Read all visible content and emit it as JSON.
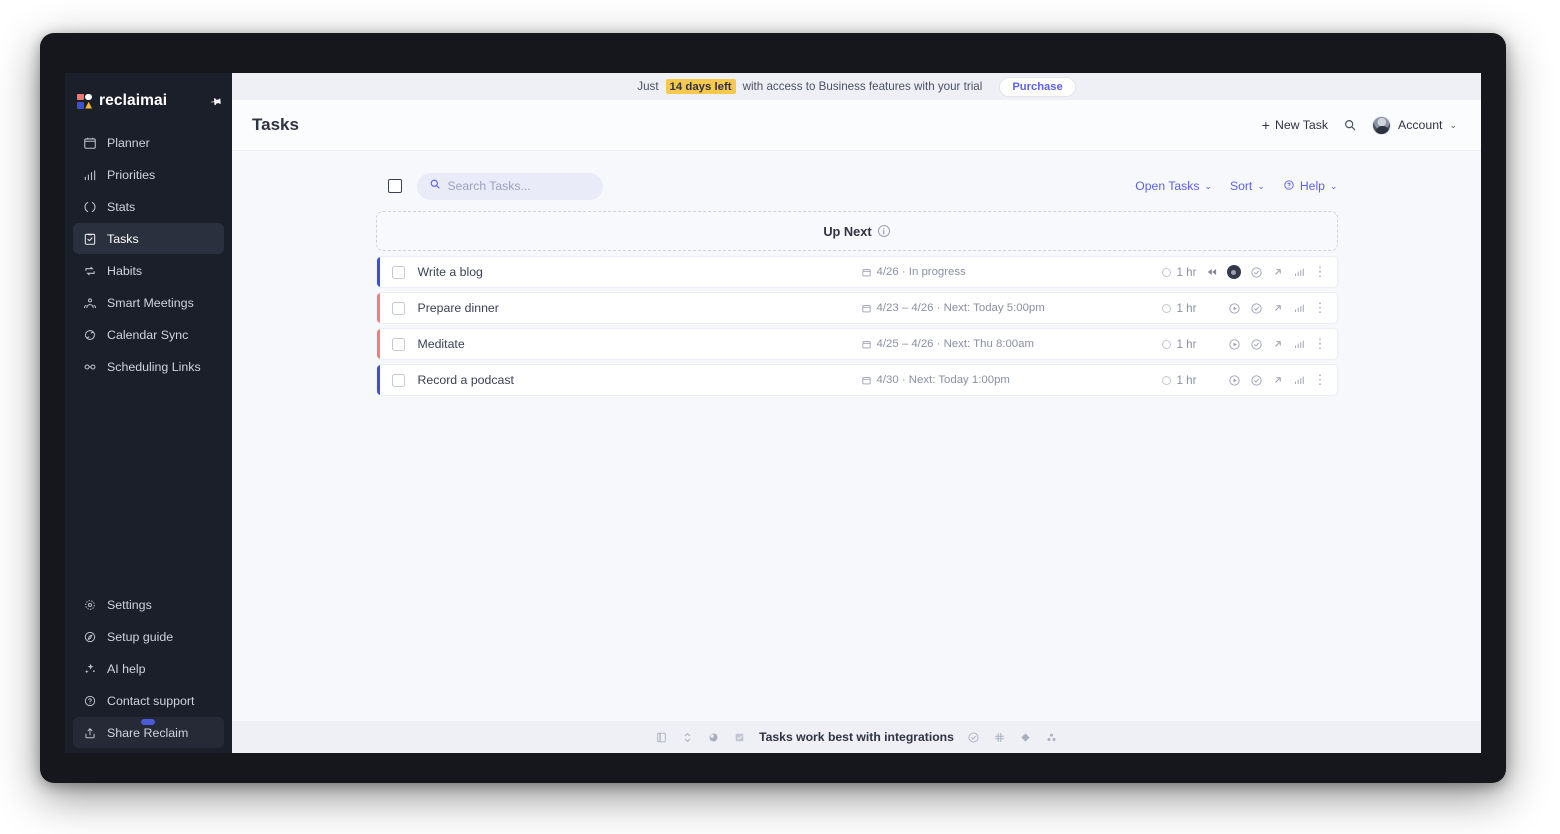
{
  "sidebar": {
    "brand": "reclaimai",
    "pin_icon": "pin-icon",
    "items": [
      {
        "label": "Planner",
        "icon": "calendar-icon",
        "active": false
      },
      {
        "label": "Priorities",
        "icon": "bar-chart-icon",
        "active": false
      },
      {
        "label": "Stats",
        "icon": "donut-chart-icon",
        "active": false
      },
      {
        "label": "Tasks",
        "icon": "clipboard-check-icon",
        "active": true
      },
      {
        "label": "Habits",
        "icon": "repeat-icon",
        "active": false
      },
      {
        "label": "Smart Meetings",
        "icon": "people-meeting-icon",
        "active": false
      },
      {
        "label": "Calendar Sync",
        "icon": "sync-icon",
        "active": false
      },
      {
        "label": "Scheduling Links",
        "icon": "link-icon",
        "active": false
      }
    ],
    "bottom_items": [
      {
        "label": "Settings",
        "icon": "gear-icon"
      },
      {
        "label": "Setup guide",
        "icon": "compass-icon"
      },
      {
        "label": "AI help",
        "icon": "sparkles-icon"
      },
      {
        "label": "Contact support",
        "icon": "question-circle-icon"
      },
      {
        "label": "Share Reclaim",
        "icon": "share-upload-icon"
      }
    ]
  },
  "banner": {
    "prefix": "Just",
    "highlight": "14 days left",
    "suffix": "with access to Business features with your trial",
    "purchase_label": "Purchase",
    "highlight_color": "#f6c84c"
  },
  "header": {
    "title": "Tasks",
    "new_task_label": "New Task",
    "new_task_plus": "+",
    "search_icon": "search-icon",
    "account_label": "Account",
    "account_caret": "⌄"
  },
  "toolbar": {
    "select_all_name": "select-all-checkbox",
    "search_placeholder": "Search Tasks...",
    "search_value": "",
    "filters": [
      {
        "label": "Open Tasks",
        "caret": "⌄",
        "icon": ""
      },
      {
        "label": "Sort",
        "caret": "⌄",
        "icon": ""
      },
      {
        "label": "Help",
        "caret": "⌄",
        "icon": "question-circle-icon"
      }
    ],
    "accent_color": "#5b62e8"
  },
  "up_next": {
    "label": "Up Next",
    "info_icon": "info-icon",
    "info_glyph": "i"
  },
  "tasks": [
    {
      "title": "Write a blog",
      "meta": "4/26 · In progress",
      "duration": "1 hr",
      "bar_color": "#3a51d6",
      "timer_state": "running",
      "actions": [
        "rewind-icon",
        "stop-timer-button",
        "mark-complete-icon",
        "open-detail-icon",
        "priority-bars-icon",
        "more-options-icon"
      ]
    },
    {
      "title": "Prepare dinner",
      "meta": "4/23 – 4/26 · Next: Today 5:00pm",
      "duration": "1 hr",
      "bar_color": "#ef8078",
      "timer_state": "idle",
      "actions": [
        "start-timer-icon",
        "mark-complete-icon",
        "open-detail-icon",
        "priority-bars-icon",
        "more-options-icon"
      ]
    },
    {
      "title": "Meditate",
      "meta": "4/25 – 4/26 · Next: Thu 8:00am",
      "duration": "1 hr",
      "bar_color": "#ef8078",
      "timer_state": "idle",
      "actions": [
        "start-timer-icon",
        "mark-complete-icon",
        "open-detail-icon",
        "priority-bars-icon",
        "more-options-icon"
      ]
    },
    {
      "title": "Record a podcast",
      "meta": "4/30 · Next: Today 1:00pm",
      "duration": "1 hr",
      "bar_color": "#3a51d6",
      "timer_state": "idle",
      "actions": [
        "start-timer-icon",
        "mark-complete-icon",
        "open-detail-icon",
        "priority-bars-icon",
        "more-options-icon"
      ]
    }
  ],
  "integrations": {
    "text": "Tasks work best with integrations",
    "left_icons": [
      "notion-icon",
      "todoist-icon",
      "asana-icon",
      "google-tasks-icon"
    ],
    "right_icons": [
      "clickup-icon",
      "slack-icon",
      "linear-icon",
      "jira-icon"
    ]
  }
}
